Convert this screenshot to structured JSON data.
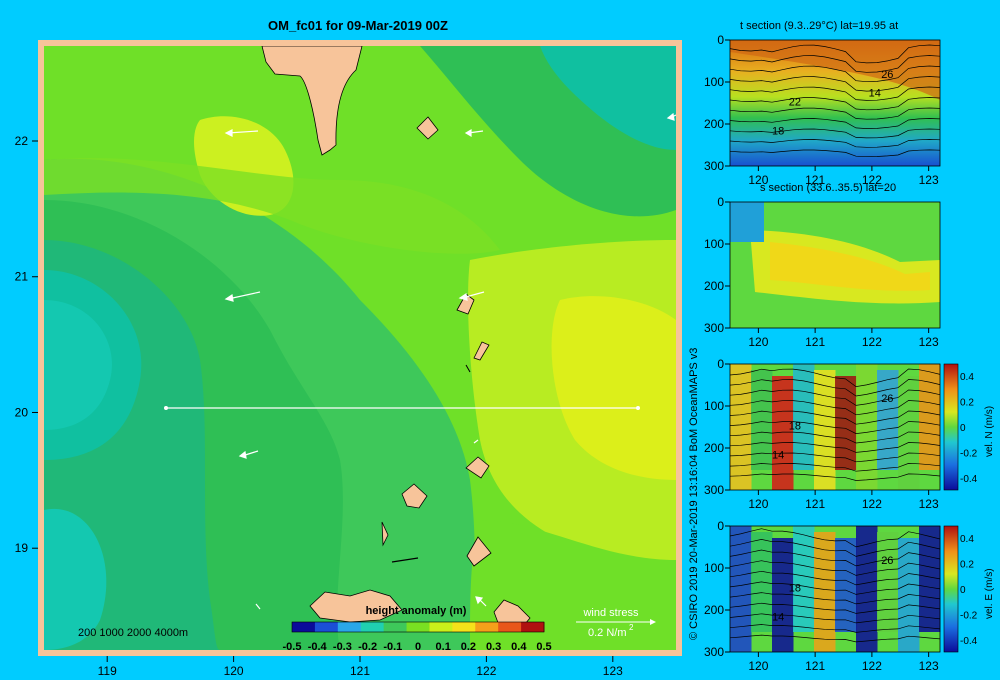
{
  "figure": {
    "title": "OM_fc01 for 09-Mar-2019 00Z",
    "credit": "© CSIRO 2019  20-Mar-2019 13:16:04 BoM OceanMAPS v3",
    "colors": {
      "background": "#00ccff",
      "land": "#f7c49a",
      "frame": "#f7c49a"
    }
  },
  "chart_data": [
    {
      "type": "heatmap",
      "name": "main-map",
      "x_ticks": [
        119,
        120,
        121,
        122,
        123
      ],
      "y_ticks": [
        19,
        20,
        21,
        22
      ],
      "xlim": [
        118.5,
        123.5
      ],
      "ylim": [
        18.25,
        22.7
      ],
      "colorbar": {
        "title": "height anomaly (m)",
        "ticks": [
          "-0.5",
          "-0.4",
          "-0.3",
          "-0.2",
          "-0.1",
          "0",
          "0.1",
          "0.2",
          "0.3",
          "0.4",
          "0.5"
        ],
        "range": [
          -0.5,
          0.5
        ],
        "colormap": [
          "#0b0b9a",
          "#1b4fd6",
          "#2aa7e8",
          "#20d0b0",
          "#3ec85a",
          "#79e022",
          "#c9f01a",
          "#f5e21a",
          "#f5a01a",
          "#e8561a",
          "#b01010"
        ]
      },
      "depth_legend": [
        "200",
        "1000",
        "2000",
        "4000m"
      ],
      "wind_stress": {
        "label": "wind stress",
        "scale": "0.2 N/m",
        "superscript": "2"
      },
      "section_line": {
        "lat": 20,
        "lon_start": 119.5,
        "lon_end": 123.2
      }
    },
    {
      "type": "heatmap",
      "name": "t-section",
      "title": "t section (9.3..29°C) lat=19.95 at",
      "x_ticks": [
        120,
        121,
        122,
        123
      ],
      "y_ticks": [
        0,
        100,
        200,
        300
      ],
      "contour_labels": [
        "26",
        "22",
        "18",
        "14"
      ]
    },
    {
      "type": "heatmap",
      "name": "s-section",
      "title": "s section (33.6..35.5) lat=20",
      "x_ticks": [
        120,
        121,
        122,
        123
      ],
      "y_ticks": [
        0,
        100,
        200,
        300
      ]
    },
    {
      "type": "heatmap",
      "name": "vel-n-section",
      "x_ticks": [
        120,
        121,
        122,
        123
      ],
      "y_ticks": [
        0,
        100,
        200,
        300
      ],
      "contour_labels": [
        "26",
        "18",
        "14"
      ],
      "colorbar": {
        "label": "vel. N (m/s)",
        "ticks": [
          "0.4",
          "0.2",
          "0",
          "-0.2",
          "-0.4"
        ]
      }
    },
    {
      "type": "heatmap",
      "name": "vel-e-section",
      "x_ticks": [
        120,
        121,
        122,
        123
      ],
      "y_ticks": [
        0,
        100,
        200,
        300
      ],
      "contour_labels": [
        "26",
        "18",
        "14"
      ],
      "colorbar": {
        "label": "vel. E (m/s)",
        "ticks": [
          "0.4",
          "0.2",
          "0",
          "-0.2",
          "-0.4"
        ]
      }
    }
  ]
}
